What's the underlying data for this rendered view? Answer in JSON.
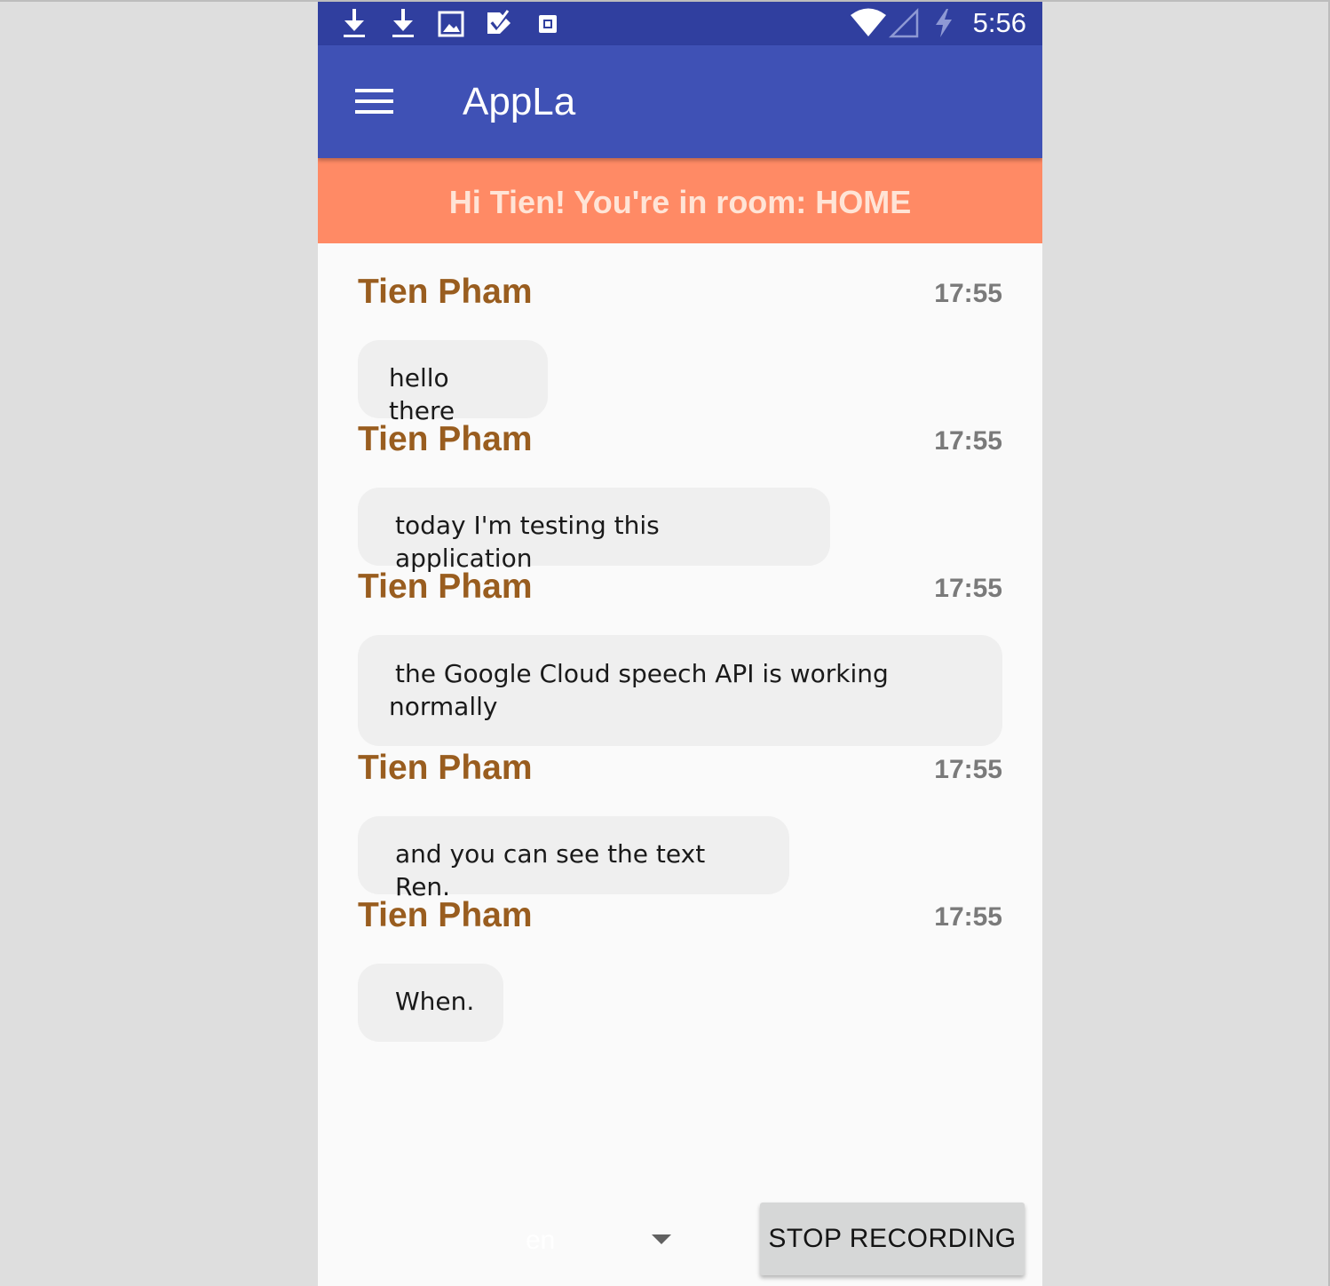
{
  "status_bar": {
    "time": "5:56",
    "left_icons": [
      "download-icon",
      "download-icon",
      "image-icon",
      "tasks-icon",
      "screenshot-icon"
    ],
    "right_icons": [
      "wifi-icon",
      "cell-signal-icon",
      "battery-charging-icon"
    ]
  },
  "app_bar": {
    "title": "AppLa",
    "menu_icon": "hamburger-menu-icon"
  },
  "banner": {
    "text": "Hi Tien! You're in room: HOME",
    "background": "#ff8a65"
  },
  "messages": [
    {
      "sender": "Tien Pham",
      "time": "17:55",
      "text": "hello there"
    },
    {
      "sender": "Tien Pham",
      "time": "17:55",
      "text": "today I'm testing this application"
    },
    {
      "sender": "Tien Pham",
      "time": "17:55",
      "text": "the Google Cloud speech API is working normally"
    },
    {
      "sender": "Tien Pham",
      "time": "17:55",
      "text": "and you can see the text Ren."
    },
    {
      "sender": "Tien Pham",
      "time": "17:55",
      "text": "When."
    }
  ],
  "controls": {
    "language": "en",
    "stop_label": "STOP RECORDING"
  },
  "colors": {
    "primary_dark": "#303f9f",
    "primary": "#3f51b5",
    "sender": "#995d1f",
    "bubble": "#efefef"
  }
}
